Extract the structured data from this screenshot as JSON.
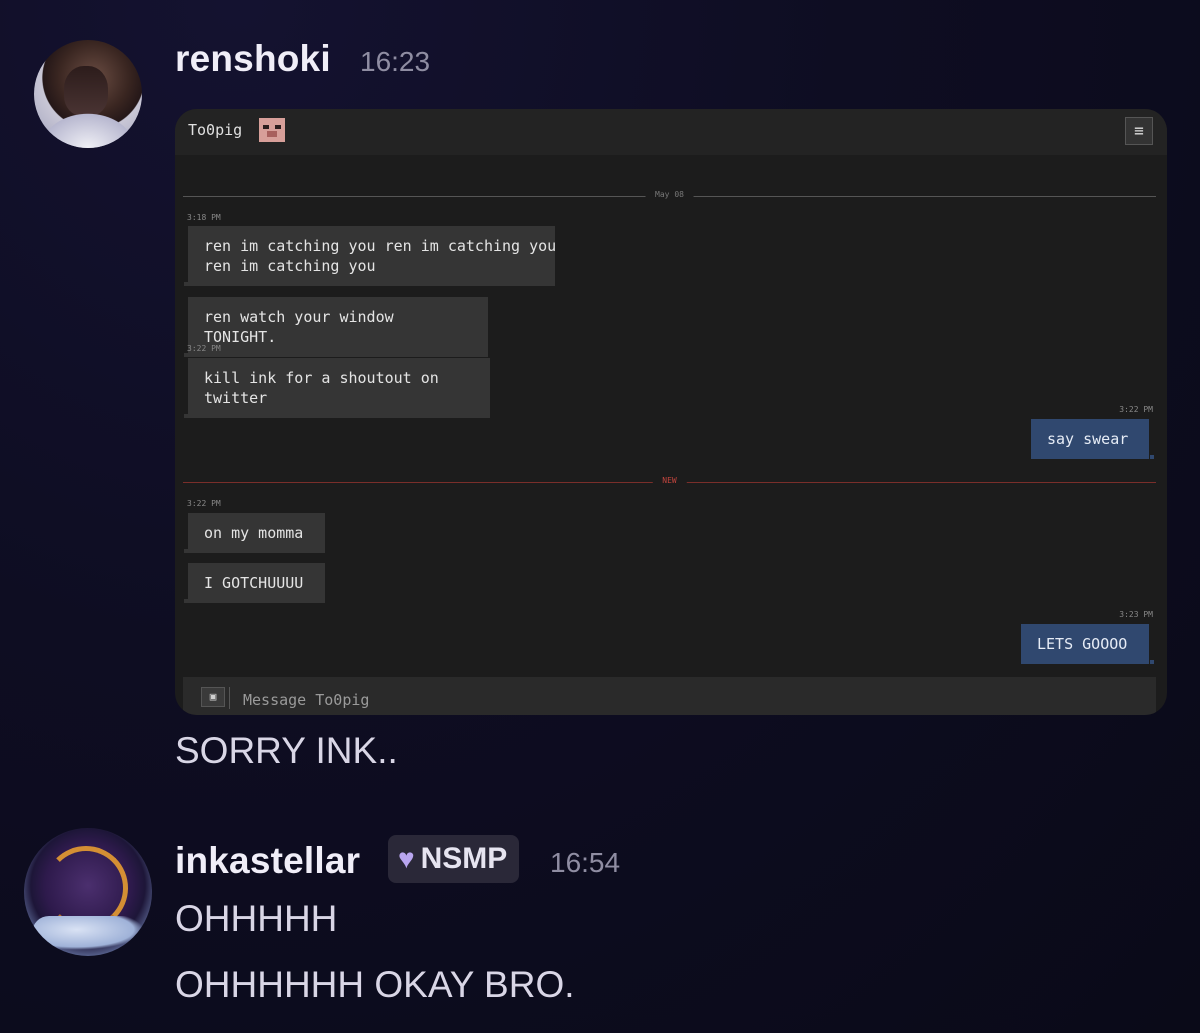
{
  "messages": [
    {
      "author": "renshoki",
      "time": "16:23",
      "embed": {
        "contact_name": "To0pig",
        "date_separator": "May 08",
        "new_separator": "NEW",
        "timestamps": [
          "3:18 PM",
          "3:22 PM",
          "3:22 PM",
          "3:22 PM",
          "3:23 PM"
        ],
        "bubbles": [
          {
            "text": "ren im catching you ren im catching you\nren im catching you",
            "from": "them"
          },
          {
            "text": "ren watch your window TONIGHT.",
            "from": "them"
          },
          {
            "text": "kill ink for a shoutout on twitter",
            "from": "them"
          },
          {
            "text": "say swear",
            "from": "me"
          },
          {
            "text": "on my momma",
            "from": "them"
          },
          {
            "text": "I GOTCHUUUU",
            "from": "them"
          },
          {
            "text": "LETS GOOOO",
            "from": "me"
          }
        ],
        "composer_placeholder": "Message To0pig",
        "menu_icon": "hamburger-icon",
        "attach_icon": "image-icon"
      },
      "text": "SORRY INK.."
    },
    {
      "author": "inkastellar",
      "badge": {
        "icon": "heart-icon",
        "color": "#b9a6f0",
        "label": "NSMP"
      },
      "time": "16:54",
      "lines": [
        "OHHHHH",
        "OHHHHHH OKAY BRO."
      ]
    }
  ]
}
